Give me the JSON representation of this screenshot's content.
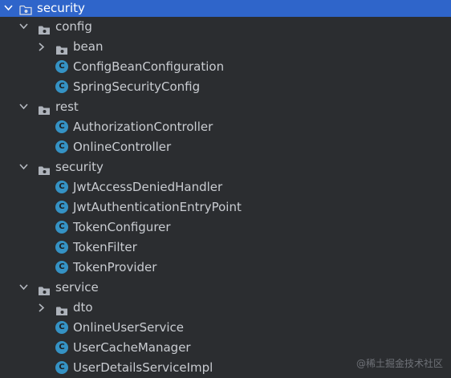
{
  "colors": {
    "background": "#2b2d30",
    "selection": "#2f65ca",
    "folder": "#aeb3bb",
    "class_icon": "#3592c4",
    "text": "#c9ccd1"
  },
  "tree": [
    {
      "label": "security",
      "kind": "folder",
      "level": 0,
      "expanded": true,
      "selected": true,
      "icon": "folder-icon"
    },
    {
      "label": "config",
      "kind": "folder",
      "level": 1,
      "expanded": true,
      "icon": "folder-icon"
    },
    {
      "label": "bean",
      "kind": "folder",
      "level": 2,
      "expanded": false,
      "icon": "folder-icon"
    },
    {
      "label": "ConfigBeanConfiguration",
      "kind": "class",
      "level": 2,
      "icon": "java-class-icon",
      "icon_letter": "C"
    },
    {
      "label": "SpringSecurityConfig",
      "kind": "class",
      "level": 2,
      "icon": "java-class-icon",
      "icon_letter": "C"
    },
    {
      "label": "rest",
      "kind": "folder",
      "level": 1,
      "expanded": true,
      "icon": "folder-icon"
    },
    {
      "label": "AuthorizationController",
      "kind": "class",
      "level": 2,
      "icon": "java-class-icon",
      "icon_letter": "C"
    },
    {
      "label": "OnlineController",
      "kind": "class",
      "level": 2,
      "icon": "java-class-icon",
      "icon_letter": "C"
    },
    {
      "label": "security",
      "kind": "folder",
      "level": 1,
      "expanded": true,
      "icon": "folder-icon"
    },
    {
      "label": "JwtAccessDeniedHandler",
      "kind": "class",
      "level": 2,
      "icon": "java-class-icon",
      "icon_letter": "C"
    },
    {
      "label": "JwtAuthenticationEntryPoint",
      "kind": "class",
      "level": 2,
      "icon": "java-class-icon",
      "icon_letter": "C"
    },
    {
      "label": "TokenConfigurer",
      "kind": "class",
      "level": 2,
      "icon": "java-class-icon",
      "icon_letter": "C"
    },
    {
      "label": "TokenFilter",
      "kind": "class",
      "level": 2,
      "icon": "java-class-icon",
      "icon_letter": "C"
    },
    {
      "label": "TokenProvider",
      "kind": "class",
      "level": 2,
      "icon": "java-class-icon",
      "icon_letter": "C"
    },
    {
      "label": "service",
      "kind": "folder",
      "level": 1,
      "expanded": true,
      "icon": "folder-icon"
    },
    {
      "label": "dto",
      "kind": "folder",
      "level": 2,
      "expanded": false,
      "icon": "folder-icon"
    },
    {
      "label": "OnlineUserService",
      "kind": "class",
      "level": 2,
      "icon": "java-class-icon",
      "icon_letter": "C"
    },
    {
      "label": "UserCacheManager",
      "kind": "class",
      "level": 2,
      "icon": "java-class-icon",
      "icon_letter": "C"
    },
    {
      "label": "UserDetailsServiceImpl",
      "kind": "class",
      "level": 2,
      "icon": "java-class-icon",
      "icon_letter": "C"
    }
  ],
  "watermark": "@稀土掘金技术社区"
}
